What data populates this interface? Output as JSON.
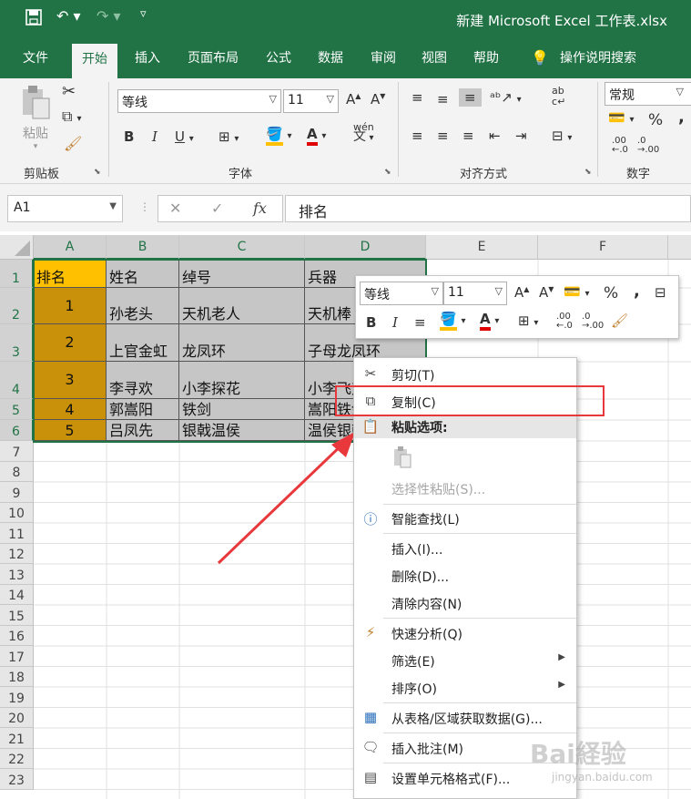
{
  "titlebar": {
    "title": "新建 Microsoft Excel 工作表.xlsx"
  },
  "tabs": [
    "文件",
    "开始",
    "插入",
    "页面布局",
    "公式",
    "数据",
    "审阅",
    "视图",
    "帮助"
  ],
  "tell_me": "操作说明搜索",
  "ribbon": {
    "paste_label": "粘贴",
    "groups": {
      "clipboard": "剪贴板",
      "font": "字体",
      "alignment": "对齐方式",
      "number": "数字"
    },
    "font_name": "等线",
    "font_size": "11",
    "bold": "B",
    "italic": "I",
    "underline": "U",
    "number_format": "常规",
    "percent": "%",
    "comma": ",",
    "inc_font": "A",
    "dec_font": "A",
    "font_color": "A",
    "wen": "wén",
    "wen_char": "文",
    "dec1": ".00",
    "dec2": ".0",
    "abc": "ab",
    "abc2": "c"
  },
  "formulabar": {
    "name_box": "A1",
    "fx": "fx",
    "value": "排名"
  },
  "columns": [
    "A",
    "B",
    "C",
    "D",
    "E",
    "F"
  ],
  "rows": [
    "1",
    "2",
    "3",
    "4",
    "5",
    "6",
    "7",
    "8",
    "9",
    "10",
    "11",
    "12",
    "13",
    "14",
    "15",
    "16",
    "17",
    "18",
    "19",
    "20",
    "21",
    "22",
    "23"
  ],
  "table": {
    "header": [
      "排名",
      "姓名",
      "绰号",
      "兵器"
    ],
    "rows": [
      [
        "1",
        "孙老头",
        "天机老人",
        "天机棒"
      ],
      [
        "2",
        "上官金虹",
        "龙凤环",
        "子母龙凤环"
      ],
      [
        "3",
        "李寻欢",
        "小李探花",
        "小李飞刀"
      ],
      [
        "4",
        "郭嵩阳",
        "铁剑",
        "嵩阳铁剑"
      ],
      [
        "5",
        "吕凤先",
        "银戟温侯",
        "温侯银戟"
      ]
    ]
  },
  "minitoolbar": {
    "font_name": "等线",
    "font_size": "11",
    "grow": "A",
    "shrink": "A",
    "percent": "%",
    "comma": ",",
    "bold": "B",
    "italic": "I",
    "font_color": "A",
    "dec1": ".00",
    "dec2": ".0"
  },
  "context_menu": {
    "cut": "剪切(T)",
    "copy": "复制(C)",
    "paste_options": "粘贴选项:",
    "paste_special": "选择性粘贴(S)...",
    "smart_lookup": "智能查找(L)",
    "insert": "插入(I)...",
    "delete": "删除(D)...",
    "clear": "清除内容(N)",
    "quick_analysis": "快速分析(Q)",
    "filter": "筛选(E)",
    "sort": "排序(O)",
    "get_data": "从表格/区域获取数据(G)...",
    "insert_comment": "插入批注(M)",
    "format_cells": "设置单元格格式(F)..."
  },
  "watermark": {
    "brand": "Bai経验",
    "url": "jingyan.baidu.com"
  },
  "colors": {
    "excel_green": "#217346",
    "highlight_red": "#e8383c",
    "orange": "#ffc000",
    "gold": "#c9910a"
  }
}
